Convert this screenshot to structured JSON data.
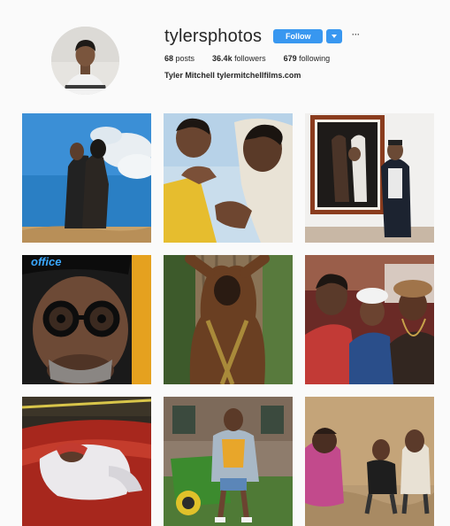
{
  "profile": {
    "username": "tylersphotos",
    "follow_label": "Follow",
    "more_label": "···",
    "posts_count": "68",
    "posts_label": "posts",
    "followers_count": "36.4k",
    "followers_label": "followers",
    "following_count": "679",
    "following_label": "following",
    "full_name": "Tyler Mitchell",
    "website": "tylermitchellfilms.com"
  },
  "colors": {
    "accent": "#3897f0",
    "background": "#fafafa",
    "text": "#262626"
  },
  "posts": [
    {
      "caption_text": ""
    },
    {
      "caption_text": ""
    },
    {
      "caption_text": ""
    },
    {
      "caption_text": "office"
    },
    {
      "caption_text": ""
    },
    {
      "caption_text": ""
    },
    {
      "caption_text": ""
    },
    {
      "caption_text": ""
    },
    {
      "caption_text": ""
    }
  ]
}
